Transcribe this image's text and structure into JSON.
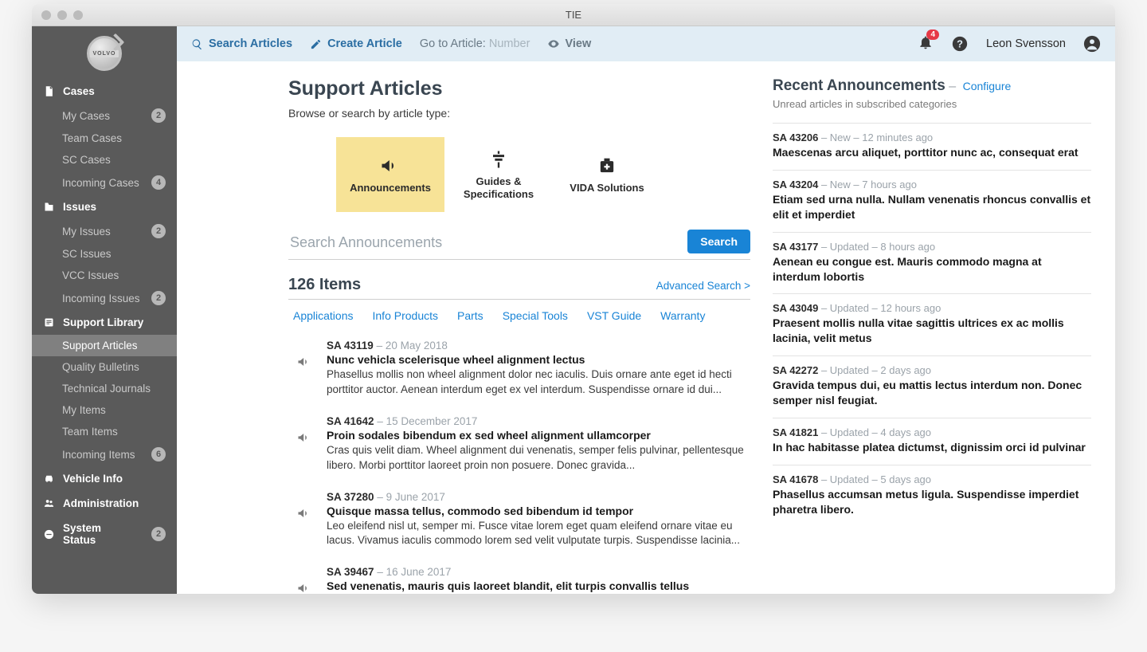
{
  "window": {
    "title": "TIE"
  },
  "topbar": {
    "search_label": "Search Articles",
    "create_label": "Create Article",
    "goto_label": "Go to Article:",
    "goto_placeholder": "Number",
    "view_label": "View",
    "notif_count": "4",
    "username": "Leon Svensson"
  },
  "sidebar": {
    "logo_text": "VOLVO",
    "sections": [
      {
        "label": "Cases",
        "items": [
          {
            "label": "My Cases",
            "badge": "2"
          },
          {
            "label": "Team Cases"
          },
          {
            "label": "SC Cases"
          },
          {
            "label": "Incoming Cases",
            "badge": "4"
          }
        ]
      },
      {
        "label": "Issues",
        "items": [
          {
            "label": "My Issues",
            "badge": "2"
          },
          {
            "label": "SC Issues"
          },
          {
            "label": "VCC Issues"
          },
          {
            "label": "Incoming Issues",
            "badge": "2"
          }
        ]
      },
      {
        "label": "Support Library",
        "items": [
          {
            "label": "Support Articles",
            "active": true
          },
          {
            "label": "Quality Bulletins"
          },
          {
            "label": "Technical Journals"
          },
          {
            "label": "My Items"
          },
          {
            "label": "Team Items"
          },
          {
            "label": "Incoming Items",
            "badge": "6"
          }
        ]
      },
      {
        "label": "Vehicle Info"
      },
      {
        "label": "Administration"
      },
      {
        "label": "System Status",
        "badge": "2"
      }
    ]
  },
  "page": {
    "title": "Support Articles",
    "subtitle": "Browse or search by article type:",
    "types": [
      {
        "label": "Announcements",
        "active": true
      },
      {
        "label": "Guides & Specifications"
      },
      {
        "label": "VIDA Solutions"
      }
    ],
    "search_placeholder": "Search Announcements",
    "search_button": "Search",
    "items_count": "126 Items",
    "advanced_search": "Advanced Search >",
    "filters": [
      "Applications",
      "Info Products",
      "Parts",
      "Special Tools",
      "VST Guide",
      "Warranty"
    ],
    "articles": [
      {
        "id": "SA 43119",
        "date": "20 May 2018",
        "title": "Nunc vehicla scelerisque wheel alignment lectus",
        "excerpt": "Phasellus mollis non wheel alignment dolor nec iaculis. Duis ornare ante eget id hecti porttitor auctor. Aenean interdum eget ex vel interdum. Suspendisse ornare id dui..."
      },
      {
        "id": "SA 41642",
        "date": "15 December 2017",
        "title": "Proin sodales bibendum ex sed wheel alignment ullamcorper",
        "excerpt": "Cras quis velit diam. Wheel alignment dui venenatis, semper felis pulvinar, pellentesque libero. Morbi porttitor laoreet proin non posuere. Donec gravida..."
      },
      {
        "id": "SA 37280",
        "date": "9 June 2017",
        "title": "Quisque massa tellus, commodo sed bibendum id tempor",
        "excerpt": "Leo eleifend nisl ut, semper mi. Fusce vitae lorem eget quam eleifend ornare vitae eu lacus. Vivamus iaculis commodo lorem sed velit vulputate turpis. Suspendisse lacinia..."
      },
      {
        "id": "SA 39467",
        "date": "16 June 2017",
        "title": "Sed venenatis, mauris quis laoreet blandit, elit turpis convallis tellus",
        "excerpt": ""
      }
    ]
  },
  "recent": {
    "title": "Recent Announcements",
    "configure": "Configure",
    "subtitle": "Unread articles in subscribed categories",
    "items": [
      {
        "id": "SA 43206",
        "status": "New",
        "time": "12 minutes ago",
        "title": "Maescenas arcu aliquet, porttitor nunc ac, consequat erat"
      },
      {
        "id": "SA 43204",
        "status": "New",
        "time": "7 hours ago",
        "title": "Etiam sed urna nulla. Nullam venenatis rhoncus convallis et elit et imperdiet"
      },
      {
        "id": "SA 43177",
        "status": "Updated",
        "time": "8 hours ago",
        "title": "Aenean eu congue est. Mauris commodo magna at interdum lobortis"
      },
      {
        "id": "SA 43049",
        "status": "Updated",
        "time": "12 hours ago",
        "title": "Praesent mollis nulla vitae sagittis ultrices ex ac mollis lacinia, velit metus"
      },
      {
        "id": "SA 42272",
        "status": "Updated",
        "time": "2 days ago",
        "title": "Gravida tempus dui, eu mattis lectus interdum non. Donec semper nisl feugiat."
      },
      {
        "id": "SA 41821",
        "status": "Updated",
        "time": "4 days ago",
        "title": "In hac habitasse platea dictumst, dignissim orci id pulvinar"
      },
      {
        "id": "SA 41678",
        "status": "Updated",
        "time": "5 days ago",
        "title": "Phasellus accumsan metus ligula. Suspendisse imperdiet pharetra libero."
      }
    ]
  }
}
